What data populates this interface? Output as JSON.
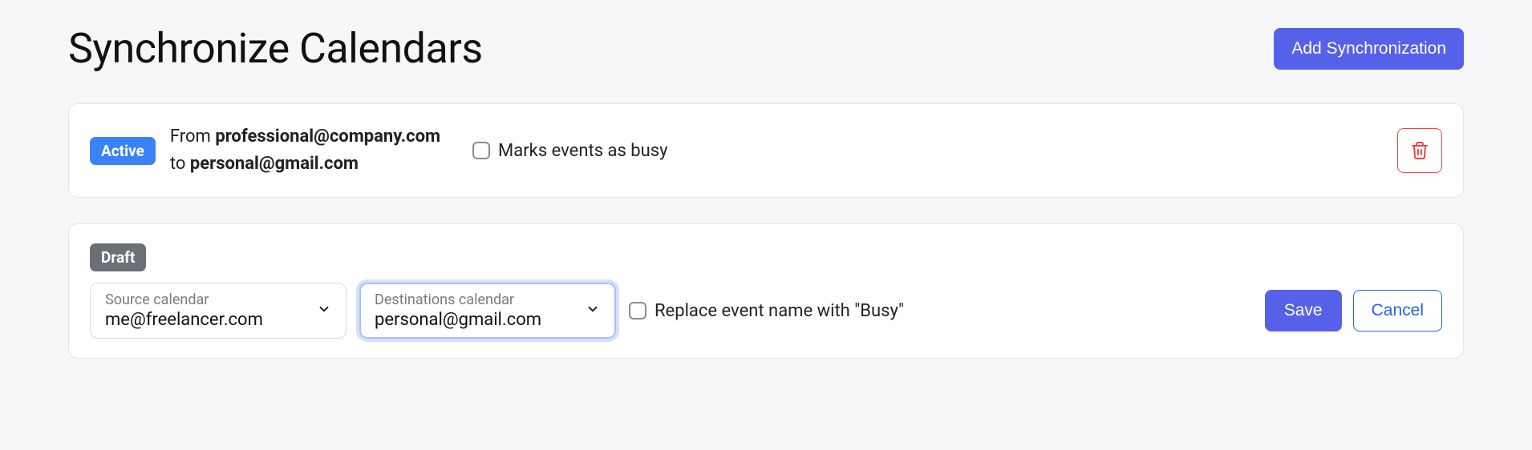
{
  "header": {
    "title": "Synchronize Calendars",
    "add_button": "Add Synchronization"
  },
  "syncs": [
    {
      "status": "Active",
      "from_label": "From ",
      "from_email": "professional@company.com",
      "to_label": "to ",
      "to_email": "personal@gmail.com",
      "option_label": "Marks events as busy"
    }
  ],
  "draft": {
    "status": "Draft",
    "source_label": "Source calendar",
    "source_value": "me@freelancer.com",
    "dest_label": "Destinations calendar",
    "dest_value": "personal@gmail.com",
    "replace_label": "Replace event name with \"Busy\"",
    "save_label": "Save",
    "cancel_label": "Cancel"
  }
}
